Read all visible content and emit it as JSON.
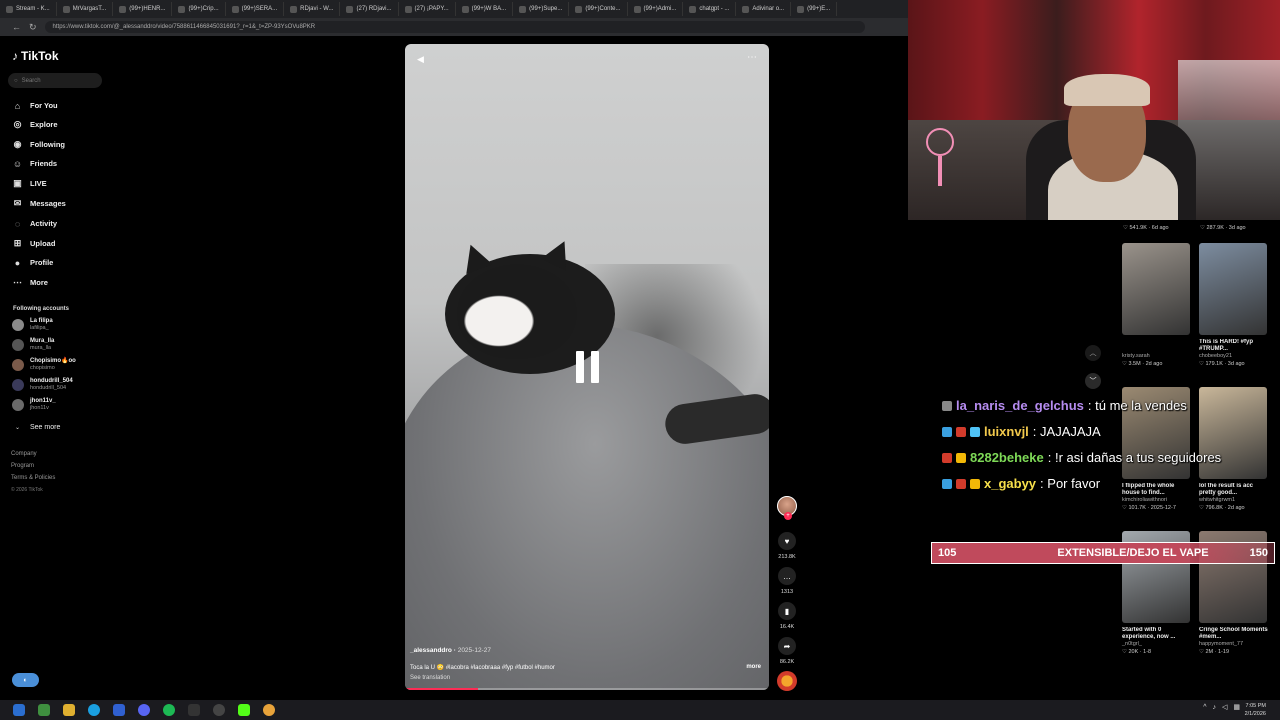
{
  "browser": {
    "tabs": [
      "Stream - K...",
      "MrVargasT...",
      "(99+)HENR...",
      "(99+)Crip...",
      "(99+)SERA...",
      "RDjavi - W...",
      "(27) RDjavi...",
      "(27) ¡PAPY...",
      "(99+)W BA...",
      "(99+)Supe...",
      "(99+)Conte...",
      "(99+)Admi...",
      "chatgpt - ...",
      "Adivinar o...",
      "(99+)E..."
    ],
    "url": "https://www.tiktok.com/@_alessanddro/video/7588611466845031691?_r=1&_t=ZP-93YsOVu8PKR"
  },
  "sidebar": {
    "logo": "TikTok",
    "search_placeholder": "Search",
    "nav": [
      {
        "label": "For You",
        "icon": "home-icon"
      },
      {
        "label": "Explore",
        "icon": "compass-icon"
      },
      {
        "label": "Following",
        "icon": "following-icon"
      },
      {
        "label": "Friends",
        "icon": "friends-icon"
      },
      {
        "label": "LIVE",
        "icon": "live-icon"
      },
      {
        "label": "Messages",
        "icon": "messages-icon"
      },
      {
        "label": "Activity",
        "icon": "activity-icon"
      },
      {
        "label": "Upload",
        "icon": "upload-icon"
      },
      {
        "label": "Profile",
        "icon": "profile-icon"
      },
      {
        "label": "More",
        "icon": "more-icon"
      }
    ],
    "following_title": "Following accounts",
    "accounts": [
      {
        "name": "La filipa",
        "handle": "lafilipa_"
      },
      {
        "name": "Mura_lla",
        "handle": "mura_lla"
      },
      {
        "name": "Chopisimo🔥oo",
        "handle": "chopisimo"
      },
      {
        "name": "hondudrill_504",
        "handle": "hondudrill_504"
      },
      {
        "name": "jhon11v_",
        "handle": "jhon11v"
      }
    ],
    "see_more": "See more",
    "footer": [
      "Company",
      "Program",
      "Terms & Policies"
    ],
    "copyright": "© 2026 TikTok"
  },
  "video": {
    "author": "_alessanddro",
    "date": "2025-12-27",
    "caption": "Toca la U 😳 #lacobra #lacobraaa #fyp #futbol #humor",
    "see_translation": "See translation",
    "more": "more",
    "progress": 0.2
  },
  "actions": {
    "likes": "213.8K",
    "comments": "1313",
    "saves": "16.4K",
    "shares": "86.2K"
  },
  "chat": [
    {
      "user": "la_naris_de_gelchus",
      "message": "tú me la vendes",
      "color": "#b68cf0"
    },
    {
      "user": "luixnvjl",
      "message": "JAJAJAJA",
      "color": "#f2c94c"
    },
    {
      "user": "8282beheke",
      "message": "!r asi dañas a tus seguidores",
      "color": "#7ed957"
    },
    {
      "user": "x_gabyy",
      "message": "Por favor",
      "color": "#f7e04b"
    }
  ],
  "goal": {
    "current": "105",
    "label": "EXTENSIBLE/DEJO EL VAPE",
    "target": "150"
  },
  "grid_top_stats": [
    {
      "likes": "541.9K",
      "time": "6d ago"
    },
    {
      "likes": "287.9K",
      "time": "3d ago"
    }
  ],
  "grid": [
    {
      "title": "",
      "author": "kristy.sarah",
      "likes": "3.5M",
      "time": "2d ago",
      "color": "#9a938b"
    },
    {
      "title": "This is HARD! #fyp #TRUMP...",
      "author": "chobeeboy21",
      "likes": "179.1K",
      "time": "3d ago",
      "color": "#7d8da0"
    },
    {
      "title": "I flipped the whole house to find...",
      "author": "kimchiroliawithnori",
      "likes": "101.7K",
      "time": "2025-12-7",
      "color": "#9b8a72"
    },
    {
      "title": "lol the result is acc pretty good...",
      "author": "whitwhitgrwm1",
      "likes": "796.8K",
      "time": "2d ago",
      "color": "#c9b79a"
    },
    {
      "title": "Started with 0 experience, now ...",
      "author": "_n0tgrl_",
      "likes": "20K",
      "time": "1-8",
      "color": "#a3a9ae"
    },
    {
      "title": "Cringe School Moments #mem...",
      "author": "happymoment_77",
      "likes": "2M",
      "time": "1-19",
      "color": "#8c7a70"
    }
  ],
  "clock": {
    "time": "7:05 PM",
    "date": "2/1/2026"
  }
}
